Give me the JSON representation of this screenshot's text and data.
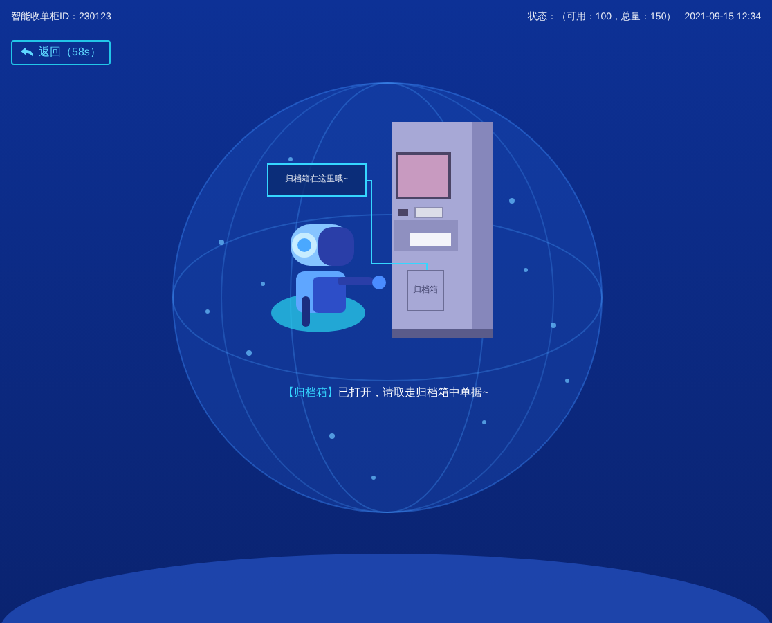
{
  "header": {
    "device_id": "智能收单柜ID：230123",
    "status": "状态：（可用：100，总量：150）",
    "datetime": "2021-09-15 12:34"
  },
  "back_button": {
    "label": "返回（58s）"
  },
  "callout": {
    "text": "归档箱在这里哦~"
  },
  "cabinet": {
    "drawer_label": "归档箱"
  },
  "message": {
    "highlight": "【归档箱】",
    "text": "已打开，请取走归档箱中单据~"
  }
}
